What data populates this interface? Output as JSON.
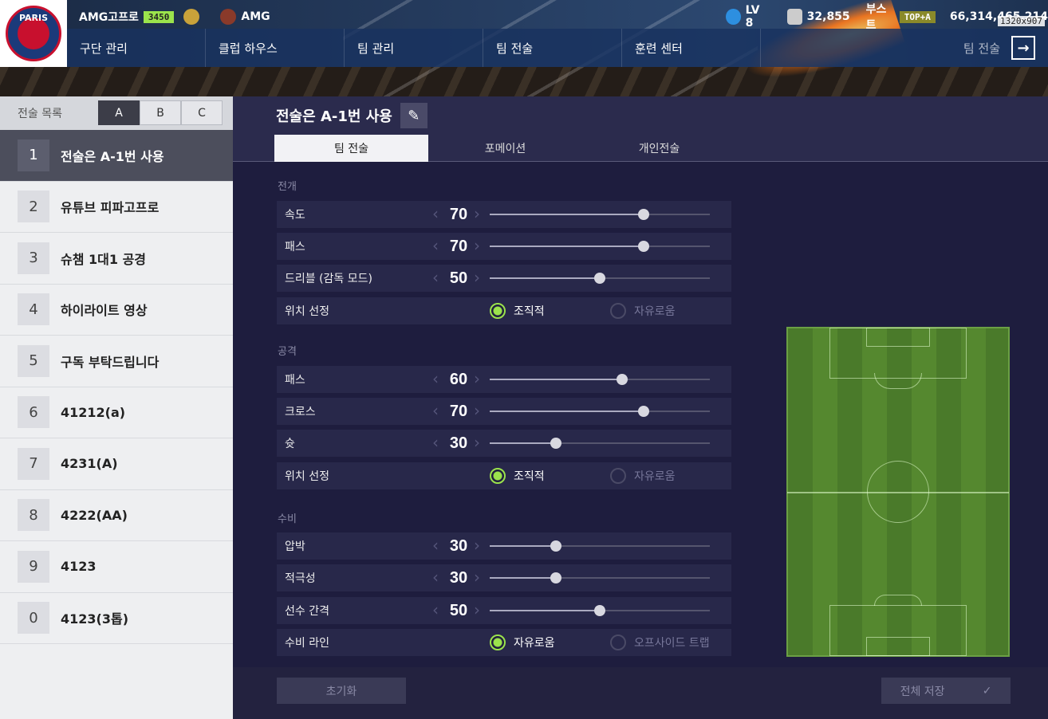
{
  "header": {
    "team_name": "AMG고프로",
    "team_score": "3450",
    "club_name": "AMG",
    "level": "LV 8",
    "points": "32,855",
    "boost_label": "부스트",
    "boost_rank": "TOP+A",
    "coins": "66,314,465,214",
    "resolution": "1320x907",
    "page_title": "팀 전술"
  },
  "logo_text": "PARIS",
  "nav": [
    "구단 관리",
    "클럽 하우스",
    "팀 관리",
    "팀 전술",
    "훈련 센터"
  ],
  "sidebar": {
    "title": "전술 목록",
    "tabs": [
      "A",
      "B",
      "C"
    ],
    "active_tab": "A",
    "items": [
      {
        "num": "1",
        "label": "전술은 A-1번 사용"
      },
      {
        "num": "2",
        "label": "유튜브 피파고프로"
      },
      {
        "num": "3",
        "label": "슈챔 1대1 공경"
      },
      {
        "num": "4",
        "label": "하이라이트 영상"
      },
      {
        "num": "5",
        "label": "구독 부탁드립니다"
      },
      {
        "num": "6",
        "label": "41212(a)"
      },
      {
        "num": "7",
        "label": "4231(A)"
      },
      {
        "num": "8",
        "label": "4222(AA)"
      },
      {
        "num": "9",
        "label": "4123"
      },
      {
        "num": "0",
        "label": "4123(3톱)"
      }
    ]
  },
  "main": {
    "title": "전술은 A-1번 사용",
    "tabs": [
      "팀 전술",
      "포메이션",
      "개인전술"
    ],
    "sections": {
      "build": "전개",
      "attack": "공격",
      "defense": "수비"
    },
    "build": {
      "speed_label": "속도",
      "speed": 70,
      "pass_label": "패스",
      "pass": 70,
      "dribble_label": "드리블 (감독 모드)",
      "dribble": 50,
      "position_label": "위치 선정",
      "opt_on": "조직적",
      "opt_off": "자유로움"
    },
    "attack": {
      "pass_label": "패스",
      "pass": 60,
      "cross_label": "크로스",
      "cross": 70,
      "shoot_label": "슛",
      "shoot": 30,
      "position_label": "위치 선정",
      "opt_on": "조직적",
      "opt_off": "자유로움"
    },
    "defense": {
      "press_label": "압박",
      "press": 30,
      "aggr_label": "적극성",
      "aggr": 30,
      "width_label": "선수 간격",
      "width": 50,
      "line_label": "수비 라인",
      "opt_on": "자유로움",
      "opt_off": "오프사이드 트랩"
    },
    "reset_label": "초기화",
    "save_label": "전체 저장"
  }
}
